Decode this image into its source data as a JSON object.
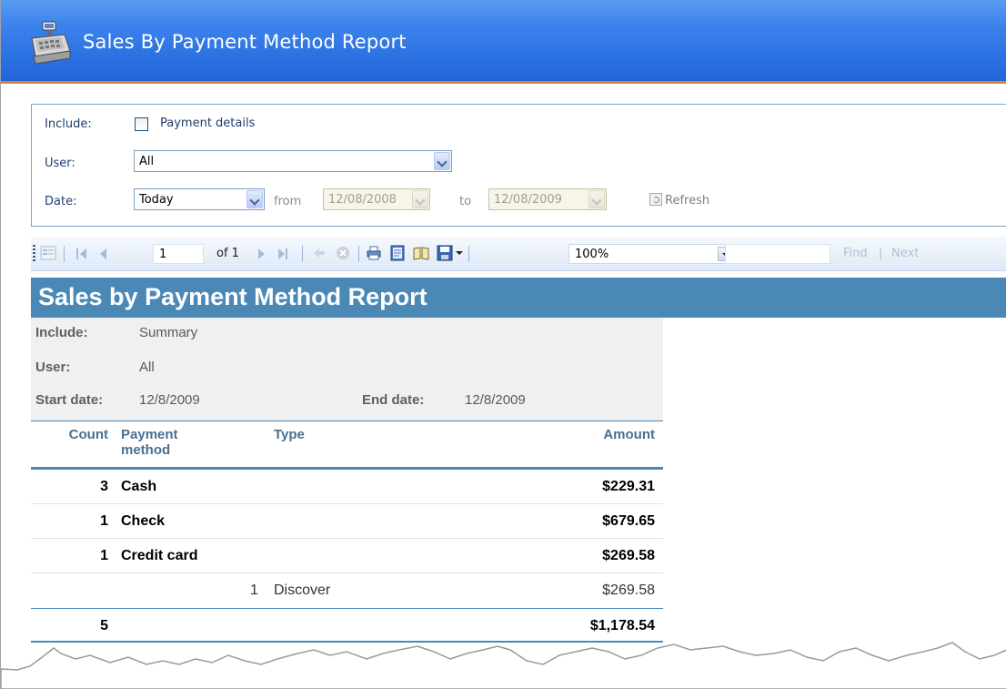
{
  "header": {
    "title": "Sales By Payment Method Report",
    "icon": "cash-register-icon"
  },
  "filters": {
    "include_label": "Include:",
    "payment_details_label": "Payment details",
    "payment_details_checked": false,
    "user_label": "User:",
    "user_value": "All",
    "date_label": "Date:",
    "date_range_value": "Today",
    "from_label": "from",
    "from_value": "12/08/2008",
    "to_label": "to",
    "to_value": "12/08/2009",
    "refresh_label": "Refresh"
  },
  "toolbar": {
    "page_value": "1",
    "page_of": "of 1",
    "zoom_value": "100%",
    "find_label": "Find",
    "find_separator": "|",
    "next_label": "Next"
  },
  "report": {
    "title": "Sales by Payment Method Report",
    "params": {
      "include_label": "Include:",
      "include_value": "Summary",
      "user_label": "User:",
      "user_value": "All",
      "start_label": "Start date:",
      "start_value": "12/8/2009",
      "end_label": "End date:",
      "end_value": "12/8/2009"
    },
    "columns": {
      "count": "Count",
      "method_line1": "Payment",
      "method_line2": "method",
      "type": "Type",
      "amount": "Amount"
    },
    "rows": [
      {
        "count": "3",
        "method": "Cash",
        "amount": "$229.31"
      },
      {
        "count": "1",
        "method": "Check",
        "amount": "$679.65"
      },
      {
        "count": "1",
        "method": "Credit card",
        "amount": "$269.58"
      }
    ],
    "detail": {
      "count": "1",
      "type": "Discover",
      "amount": "$269.58"
    },
    "total": {
      "count": "5",
      "amount": "$1,178.54"
    }
  },
  "colors": {
    "header_blue": "#2a6fe0",
    "header_accent": "#e1803c",
    "report_title_bar": "#4a88b6",
    "params_background": "#f0f0f0"
  }
}
